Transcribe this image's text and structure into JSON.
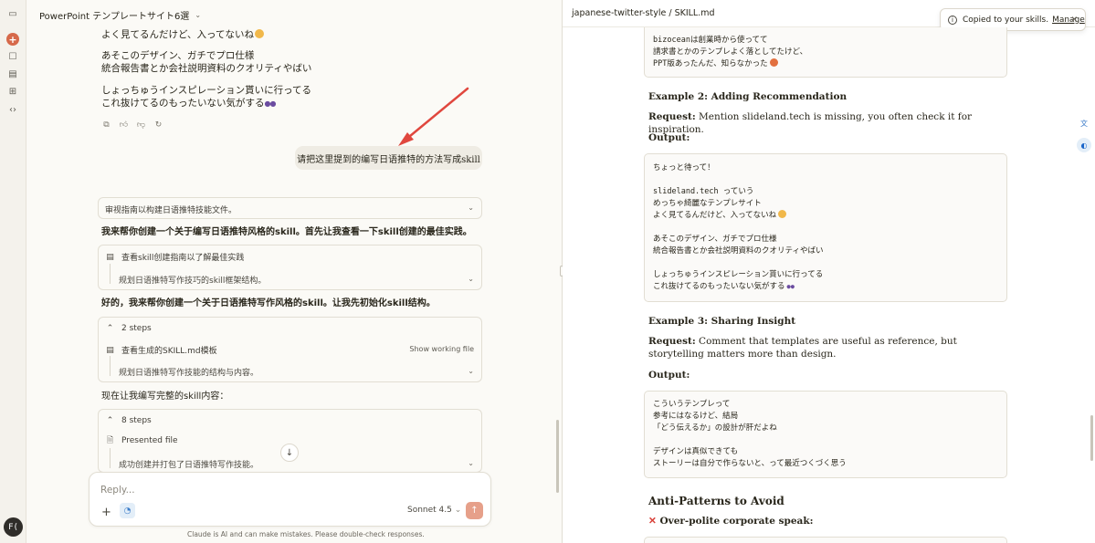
{
  "chat": {
    "title": "PowerPoint テンプレートサイト6選",
    "lines_top": [
      "よく見てるんだけど、入ってないね",
      "あそこのデザイン、ガチでプロ仕様",
      "統合報告書とか会社説明資料のクオリティやばい",
      "しょっちゅうインスピレーション貰いに行ってる",
      "これ抜けてるのもったいない気がする"
    ],
    "user_message": "请把这里提到的编写日语推特的方法写成skill",
    "box1_label": "审视指南以构建日语推特技能文件。",
    "para1": "我来帮你创建一个关于编写日语推特风格的skill。首先让我查看一下skill创建的最佳实践。",
    "box2": {
      "item1": "查看skill创建指南以了解最佳实践",
      "item2": "规划日语推特写作技巧的skill框架结构。"
    },
    "para2": "好的，我来帮你创建一个关于日语推特写作风格的skill。让我先初始化skill结构。",
    "box3": {
      "steps": "2 steps",
      "item1": "查看生成的SKILL.md模板",
      "show_file": "Show working file",
      "item2": "规划日语推特写作技能的结构与内容。"
    },
    "para3": "现在让我编写完整的skill内容：",
    "box4": {
      "steps": "8 steps",
      "item1": "Presented file",
      "item2": "成功创建并打包了日语推特写作技能。"
    },
    "composer": {
      "placeholder": "Reply...",
      "model": "Sonnet 4.5"
    },
    "disclaimer": "Claude is AI and can make mistakes. Please double-check responses."
  },
  "rail": {
    "avatar": "F("
  },
  "doc": {
    "path": "japanese-twitter-style / SKILL.md",
    "toast": {
      "message": "Copied to your skills.",
      "link": "Manage"
    },
    "code1": [
      "bizoceanは創業時から使ってて",
      "請求書とかのテンプレよく落としてたけど、",
      "PPT版あったんだ、知らなかった"
    ],
    "example2_title": "Example 2: Adding Recommendation",
    "example2_request_label": "Request:",
    "example2_request": "Mention slideland.tech is missing, you often check it for inspiration.",
    "output_label": "Output:",
    "code2": [
      "ちょっと待って！",
      "",
      "slideland.tech っていう",
      "めっちゃ綺麗なテンプレサイト",
      "よく見てるんだけど、入ってないね",
      "",
      "あそこのデザイン、ガチでプロ仕様",
      "統合報告書とか会社説明資料のクオリティやばい",
      "",
      "しょっちゅうインスピレーション貰いに行ってる",
      "これ抜けてるのもったいない気がする"
    ],
    "example3_title": "Example 3: Sharing Insight",
    "example3_request_label": "Request:",
    "example3_request": "Comment that templates are useful as reference, but storytelling matters more than design.",
    "code3": [
      "こういうテンプレって",
      "参考にはなるけど、結局",
      "「どう伝えるか」の設計が肝だよね",
      "",
      "デザインは真似できても",
      "ストーリーは自分で作らないと、って最近つくづく思う"
    ],
    "antipatterns_title": "Anti-Patterns to Avoid",
    "antipattern1": "Over-polite corporate speak:"
  },
  "colors": {
    "accent": "#d6694a",
    "arrow": "#e0473e",
    "bg": "#fbfaf6"
  }
}
